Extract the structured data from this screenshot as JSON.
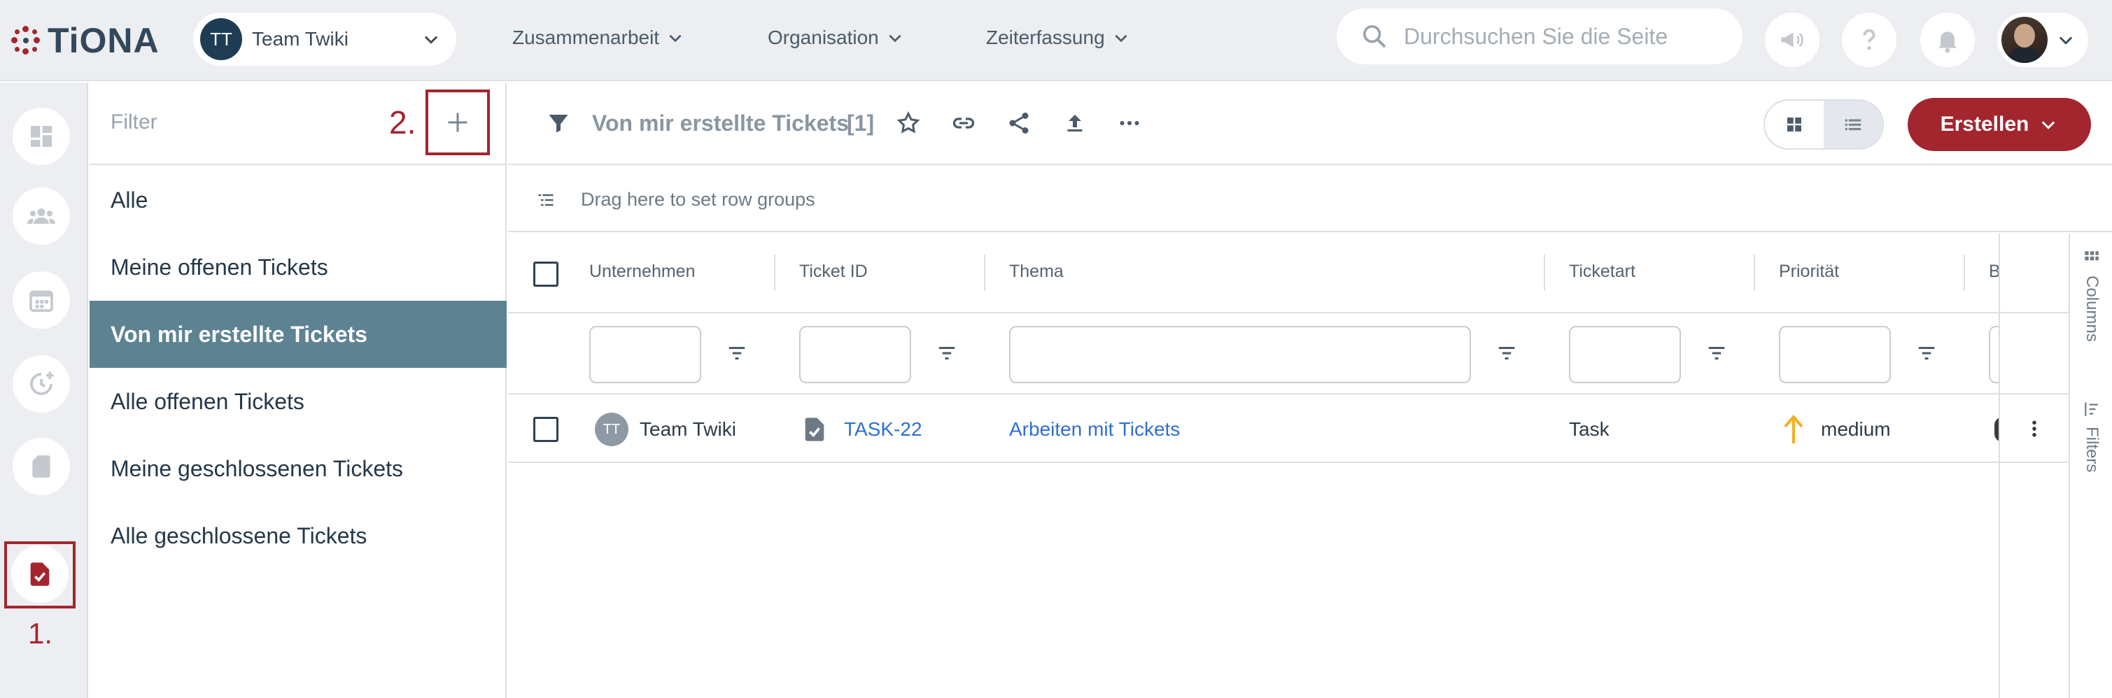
{
  "brand": {
    "name": "TiONA"
  },
  "team": {
    "initials": "TT",
    "name": "Team Twiki"
  },
  "nav": {
    "items": [
      "Zusammenarbeit",
      "Organisation",
      "Zeiterfassung"
    ]
  },
  "search": {
    "placeholder": "Durchsuchen Sie die Seite",
    "value": ""
  },
  "header_icons": [
    "megaphone-icon",
    "help-icon",
    "bell-icon",
    "user-avatar"
  ],
  "rail": {
    "icons": [
      "dashboard-icon",
      "team-icon",
      "calendar-icon",
      "time-tracking-icon",
      "document-icon",
      "ticket-icon"
    ],
    "step_label": "1."
  },
  "filter_panel": {
    "title": "Filter",
    "step_label": "2.",
    "items": [
      {
        "label": "Alle",
        "active": false
      },
      {
        "label": "Meine offenen Tickets",
        "active": false
      },
      {
        "label": "Von mir erstellte Tickets",
        "active": true
      },
      {
        "label": "Alle offenen Tickets",
        "active": false
      },
      {
        "label": "Meine geschlossenen Tickets",
        "active": false
      },
      {
        "label": "Alle geschlossene Tickets",
        "active": false
      }
    ]
  },
  "toolbar": {
    "title": "Von mir erstellte Tickets",
    "count": "[1]",
    "create_label": "Erstellen",
    "icons": [
      "filter-icon",
      "star-icon",
      "link-icon",
      "share-icon",
      "upload-icon",
      "more-icon"
    ],
    "view_modes": [
      "grid-view",
      "list-view"
    ],
    "active_view": "list-view"
  },
  "group_bar": {
    "text": "Drag here to set row groups"
  },
  "table": {
    "columns": [
      "Unternehmen",
      "Ticket ID",
      "Thema",
      "Ticketart",
      "Priorität",
      "B"
    ],
    "rows": [
      {
        "company_initials": "TT",
        "company": "Team Twiki",
        "ticket_id": "TASK-22",
        "topic": "Arbeiten mit Tickets",
        "type": "Task",
        "priority": "medium"
      }
    ]
  },
  "side_tools": {
    "columns": "Columns",
    "filters": "Filters"
  },
  "colors": {
    "accent": "#a3262e",
    "active_filter": "#5d8393",
    "link": "#2f6fd1",
    "priority_medium": "#f2b01e"
  }
}
